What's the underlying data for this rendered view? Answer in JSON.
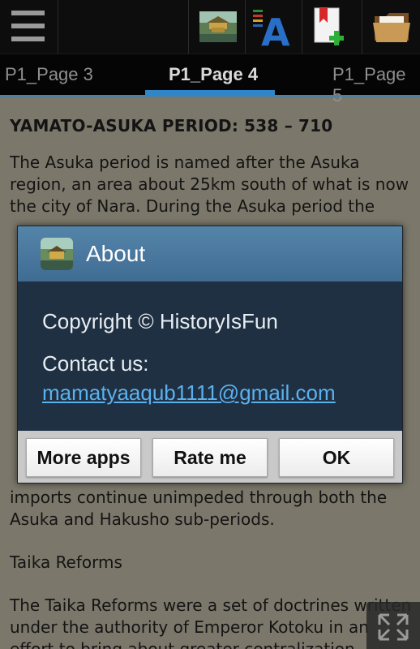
{
  "actionbar": {
    "icons": [
      "menu-icon",
      "pavilion-thumbnail-icon",
      "font-size-icon",
      "add-bookmark-icon",
      "folder-icon"
    ]
  },
  "tabs": [
    {
      "label": "P1_Page 3",
      "active": false
    },
    {
      "label": "P1_Page 4",
      "active": true
    },
    {
      "label": "P1_Page 5",
      "active": false
    }
  ],
  "content": {
    "heading": "YAMATO-ASUKA PERIOD: 538 – 710",
    "paragraph1": "The Asuka period is named after the Asuka region, an area about 25km south of what is now the city of Nara. During the Asuka period the",
    "paragraph1_tail": "imports continue unimpeded through both the Asuka and Hakusho sub-periods.",
    "subheading": "Taika Reforms",
    "paragraph2": "The Taika Reforms were a set of doctrines written under the authority of Emperor Kotoku in an effort to bring about greater centralization"
  },
  "dialog": {
    "title": "About",
    "copyright": "Copyright © HistoryIsFun",
    "contact_label": "Contact us:",
    "email": "mamatyaaqub1111@gmail.com",
    "buttons": {
      "more_apps": "More apps",
      "rate_me": "Rate me",
      "ok": "OK"
    }
  },
  "colors": {
    "accent": "#2f86c8",
    "page_bg": "#7b776a",
    "dialog_title": "#4a78a0",
    "dialog_body": "#1f3042",
    "link": "#5bb1ee"
  }
}
